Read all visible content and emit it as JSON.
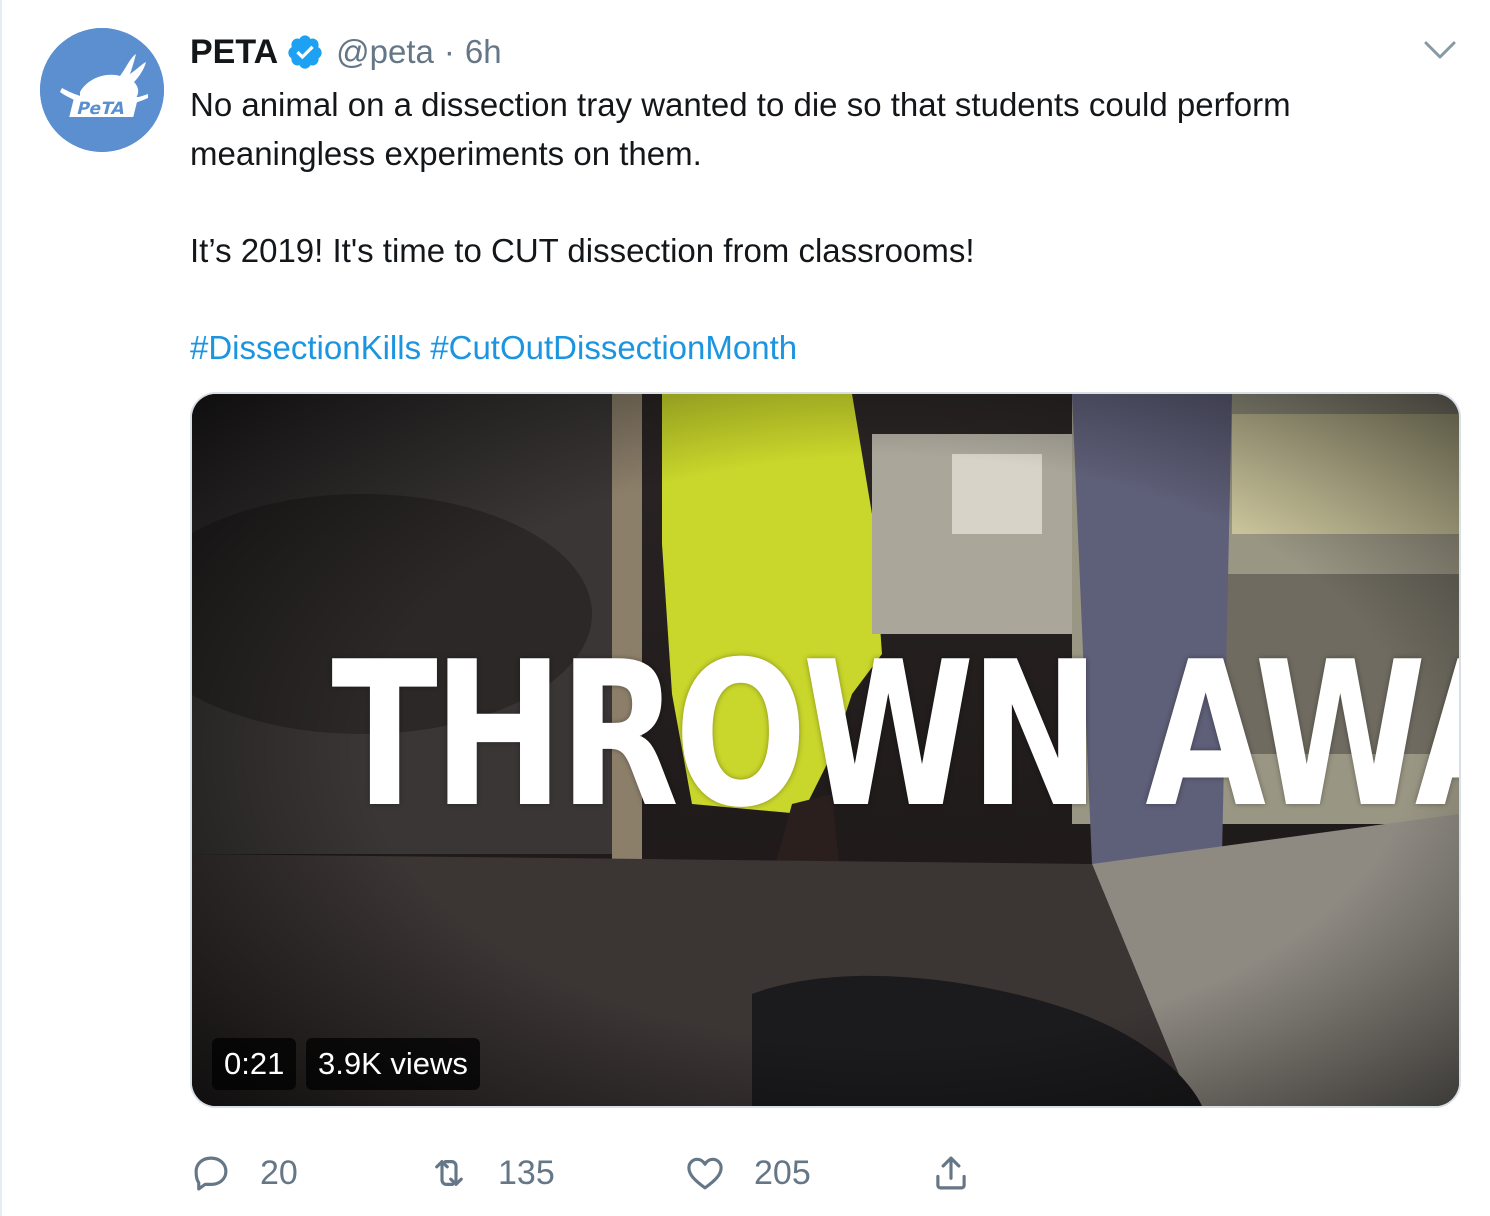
{
  "tweet": {
    "author": {
      "display_name": "PETA",
      "handle": "@peta",
      "verified": true,
      "avatar_text": "PeTA",
      "avatar_color": "#5b8fcf"
    },
    "separator": "·",
    "time": "6h",
    "paragraphs": [
      "No animal on a dissection tray wanted to die so that students could perform meaningless experiments on them.",
      "It’s 2019! It's time to CUT dissection from classrooms!"
    ],
    "hashtags": [
      "#DissectionKills",
      "#CutOutDissectionMonth"
    ],
    "media": {
      "type": "video",
      "overlay_text": "THROWN AWAY",
      "duration": "0:21",
      "views": "3.9K views"
    },
    "stats": {
      "replies": "20",
      "retweets": "135",
      "likes": "205"
    }
  },
  "icons": {
    "verified": "verified-badge-icon",
    "menu": "chevron-down-icon",
    "reply": "reply-icon",
    "retweet": "retweet-icon",
    "like": "heart-icon",
    "share": "share-icon"
  },
  "colors": {
    "link": "#1b95e0",
    "secondary_text": "#657786",
    "verified_blue": "#1da1f2",
    "border": "#e6ecf0"
  }
}
